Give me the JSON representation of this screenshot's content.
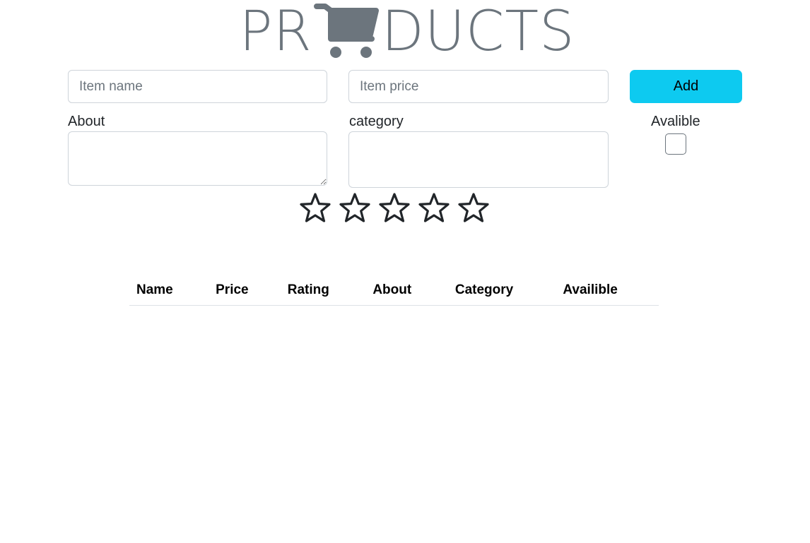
{
  "header": {
    "title_left": "PR",
    "title_icon": "cart-icon",
    "title_right": "DUCTS",
    "title_color": "#6c757d"
  },
  "form": {
    "name_placeholder": "Item name",
    "name_value": "",
    "price_placeholder": "Item price",
    "price_value": "",
    "add_label": "Add",
    "add_color": "#0dcaf0",
    "about_label": "About",
    "about_value": "",
    "category_label": "category",
    "category_value": "",
    "available_label": "Avalible",
    "available_checked": false
  },
  "rating": {
    "max": 5,
    "value": 0,
    "icon": "star-outline-icon"
  },
  "table": {
    "headers": [
      "Name",
      "Price",
      "Rating",
      "About",
      "Category",
      "Availible"
    ],
    "rows": []
  }
}
